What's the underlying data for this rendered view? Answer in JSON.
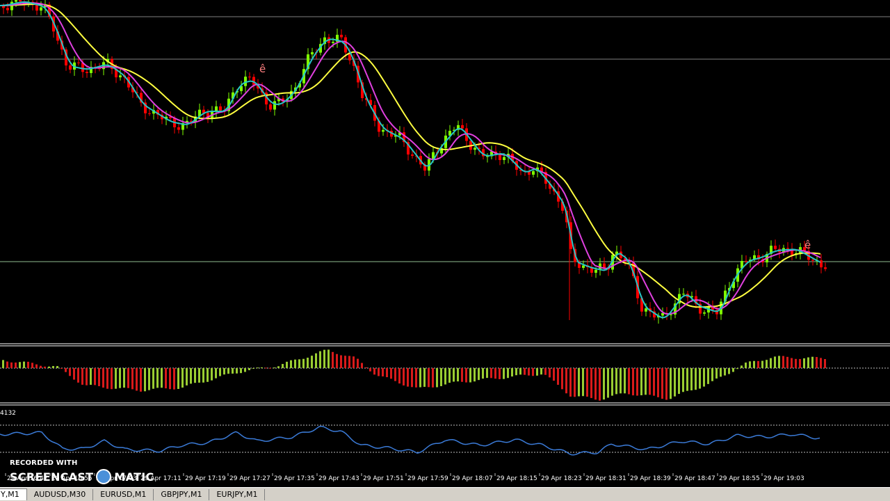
{
  "chart": {
    "osc_label": "4132",
    "marker_glyph": "ê",
    "time_labels": [
      "29 Apr 16:47",
      "29 Apr 16:55",
      "29 Apr 17:03",
      "29 Apr 17:11",
      "29 Apr 17:19",
      "29 Apr 17:27",
      "29 Apr 17:35",
      "29 Apr 17:43",
      "29 Apr 17:51",
      "29 Apr 17:59",
      "29 Apr 18:07",
      "29 Apr 18:15",
      "29 Apr 18:23",
      "29 Apr 18:31",
      "29 Apr 18:39",
      "29 Apr 18:47",
      "29 Apr 18:55",
      "29 Apr 19:03"
    ]
  },
  "colors": {
    "background": "#000000",
    "bull": "#7fff00",
    "bear": "#ff0000",
    "bull_hist": "#9acd32",
    "bear_hist": "#d91a1a",
    "ma_fast": "#26c6c6",
    "ma_mid": "#e040e0",
    "ma_slow": "#ffff40",
    "oscillator": "#3b7bd8",
    "marker": "#ff8080",
    "grid": "#808080"
  },
  "tabs": [
    "Y,M1",
    "AUDUSD,M30",
    "EURUSD,M1",
    "GBPJPY,M1",
    "EURJPY,M1"
  ],
  "watermark": {
    "line1": "RECORDED WITH",
    "brand_left": "SCREENCAST",
    "brand_right": "MATIC"
  }
}
